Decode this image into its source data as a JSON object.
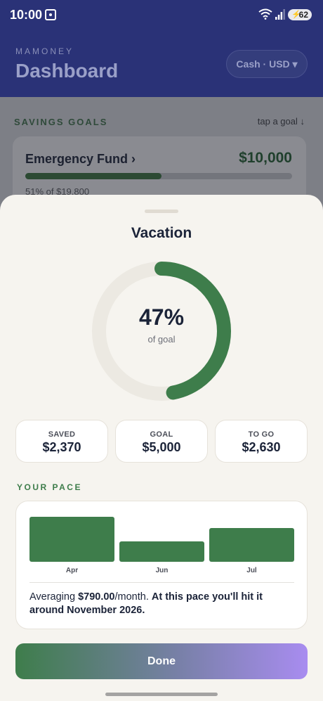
{
  "status_bar": {
    "time": "10:00",
    "battery": "62",
    "wifi_badge": "5"
  },
  "header": {
    "brand": "MAMONEY",
    "title": "Dashboard",
    "currency_selector": "Cash · USD ▾"
  },
  "savings": {
    "section_label": "SAVINGS GOALS",
    "hint": "tap a goal ↓",
    "first_goal": {
      "name": "Emergency Fund ›",
      "amount": "$10,000",
      "progress_pct": 51,
      "subtitle": "51% of $19,800"
    }
  },
  "sheet": {
    "title": "Vacation",
    "ring": {
      "percent_text": "47%",
      "sub": "of goal",
      "value": 0.47
    },
    "stats": [
      {
        "label": "SAVED",
        "value": "$2,370"
      },
      {
        "label": "GOAL",
        "value": "$5,000"
      },
      {
        "label": "TO GO",
        "value": "$2,630"
      }
    ],
    "pace_label": "YOUR PACE",
    "pace_chart": {
      "months": [
        "Apr",
        "Jun",
        "Jul"
      ],
      "relative_heights": [
        1.0,
        0.46,
        0.75
      ]
    },
    "pace_text": {
      "prefix": "Averaging ",
      "amount": "$790.00",
      "suffix": "/month. ",
      "projection": "At this pace you'll hit it around November 2026."
    },
    "done_label": "Done"
  },
  "colors": {
    "accent_green": "#3e7d4b",
    "navy": "#1b2338",
    "header_bg": "#2a3277",
    "gradient_end": "#a88cf0"
  }
}
